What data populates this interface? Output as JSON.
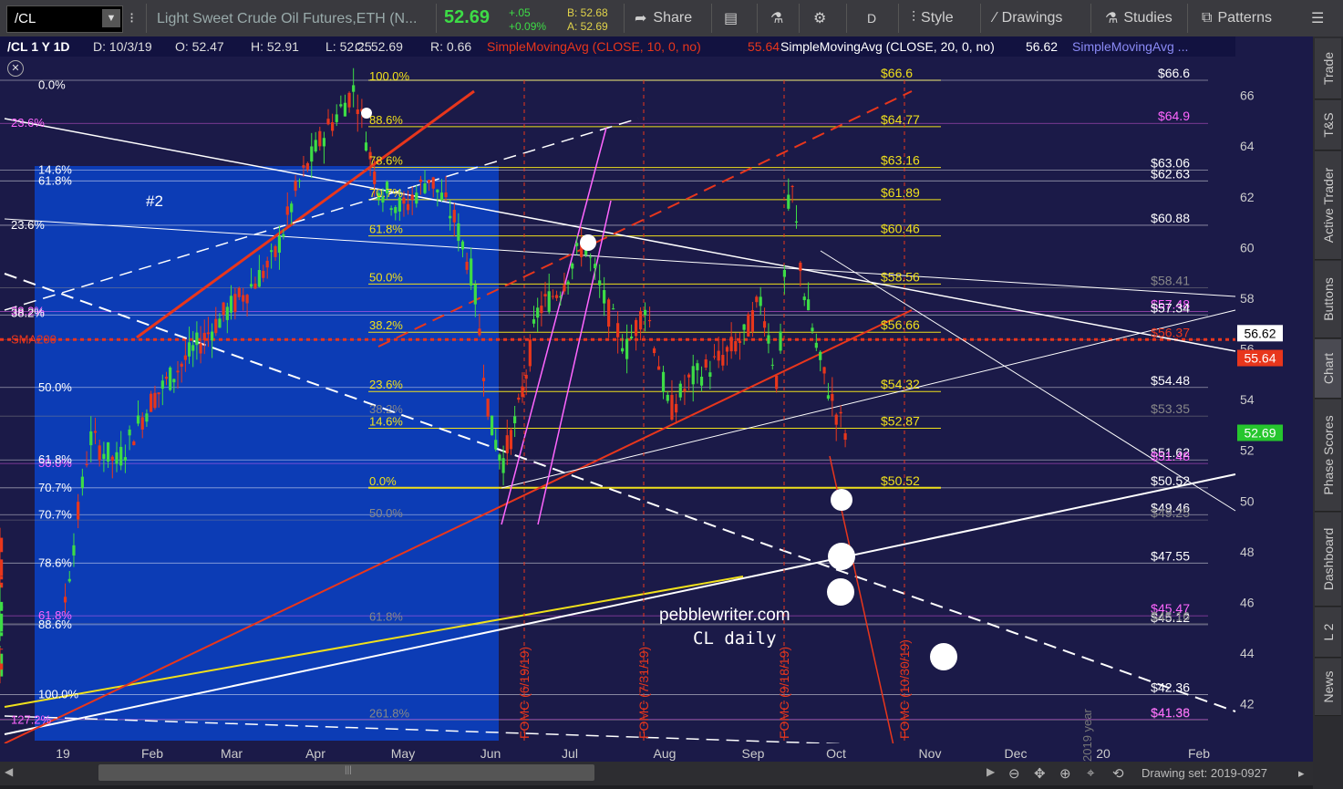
{
  "toolbar": {
    "symbol": "/CL",
    "description": "Light Sweet Crude Oil Futures,ETH (N...",
    "last": "52.69",
    "change": "+.05",
    "change_pct": "+0.09%",
    "bid": "B: 52.68",
    "ask": "A: 52.69",
    "share_label": "Share",
    "period_label": "D",
    "style_label": "Style",
    "drawings_label": "Drawings",
    "studies_label": "Studies",
    "patterns_label": "Patterns"
  },
  "header": {
    "symbol": "/CL 1 Y 1D",
    "date": "D: 10/3/19",
    "open": "O: 52.47",
    "high": "H: 52.91",
    "low": "L: 52.25",
    "close": "C: 52.69",
    "range": "R: 0.66",
    "sma10_label": "SimpleMovingAvg (CLOSE, 10, 0, no)",
    "sma10_value": "55.64",
    "sma20_label": "SimpleMovingAvg (CLOSE, 20, 0, no)",
    "sma20_value": "56.62",
    "sma_more_label": "SimpleMovingAvg ..."
  },
  "right_tabs": [
    "Trade",
    "T&S",
    "Active Trader",
    "Buttons",
    "Chart",
    "Phase Scores",
    "Dashboard",
    "L 2",
    "News"
  ],
  "status": {
    "drawing_set": "Drawing set: 2019-0927"
  },
  "colors": {
    "background": "#1b1a48",
    "highlight": "#0c3cb5",
    "sma10": "#e8361c",
    "sma20": "#ffffff",
    "sma50": "#7b7bf0",
    "sma200": "#f0e01c",
    "up": "#3ddc46",
    "down": "#e8361c",
    "fib_pink": "#ff66ff"
  },
  "chart_data": {
    "type": "candlestick",
    "yaxis": {
      "range": [
        41.3,
        66.6
      ],
      "ticks": [
        42,
        44,
        46,
        48,
        50,
        52,
        54,
        56,
        58,
        60,
        62,
        64,
        66
      ]
    },
    "xaxis": {
      "ticks": [
        "19",
        "Feb",
        "Mar",
        "Apr",
        "May",
        "Jun",
        "Jul",
        "Aug",
        "Sep",
        "Oct",
        "Nov",
        "Dec",
        "20",
        "Feb"
      ]
    },
    "ohlc_last": {
      "open": 52.47,
      "high": 52.91,
      "low": 52.25,
      "close": 52.69
    },
    "price_levels": [
      {
        "value": 66.6,
        "label": "$66.6",
        "color": "#f0e01c"
      },
      {
        "value": 64.77,
        "label": "$64.77",
        "color": "#f0e01c"
      },
      {
        "value": 63.16,
        "label": "$63.16",
        "color": "#f0e01c"
      },
      {
        "value": 61.89,
        "label": "$61.89",
        "color": "#f0e01c"
      },
      {
        "value": 60.46,
        "label": "$60.46",
        "color": "#f0e01c"
      },
      {
        "value": 58.56,
        "label": "$58.56",
        "color": "#f0e01c"
      },
      {
        "value": 56.66,
        "label": "$56.66",
        "color": "#f0e01c"
      },
      {
        "value": 54.32,
        "label": "$54.32",
        "color": "#f0e01c"
      },
      {
        "value": 52.87,
        "label": "$52.87",
        "color": "#f0e01c"
      },
      {
        "value": 50.52,
        "label": "$50.52",
        "color": "#f0e01c"
      }
    ],
    "right_levels": [
      {
        "value": 66.6,
        "label": "$66.6",
        "color": "#ffffff"
      },
      {
        "value": 64.9,
        "label": "$64.9",
        "color": "#ff66ff"
      },
      {
        "value": 63.06,
        "label": "$63.06",
        "color": "#ffffff"
      },
      {
        "value": 62.63,
        "label": "$62.63",
        "color": "#ffffff"
      },
      {
        "value": 60.88,
        "label": "$60.88",
        "color": "#ffffff"
      },
      {
        "value": 58.41,
        "label": "$58.41",
        "color": "#888888"
      },
      {
        "value": 57.48,
        "label": "$57.48",
        "color": "#ff66ff"
      },
      {
        "value": 57.34,
        "label": "$57.34",
        "color": "#ffffff"
      },
      {
        "value": 56.37,
        "label": "$56.37",
        "color": "#e8361c"
      },
      {
        "value": 54.48,
        "label": "$54.48",
        "color": "#ffffff"
      },
      {
        "value": 53.35,
        "label": "$53.35",
        "color": "#888888"
      },
      {
        "value": 51.62,
        "label": "$51.62",
        "color": "#ffffff"
      },
      {
        "value": 51.48,
        "label": "$51.48",
        "color": "#ff66ff"
      },
      {
        "value": 50.52,
        "label": "$50.52",
        "color": "#ffffff"
      },
      {
        "value": 49.46,
        "label": "$49.46",
        "color": "#ffffff"
      },
      {
        "value": 49.25,
        "label": "$49.25",
        "color": "#888888"
      },
      {
        "value": 47.55,
        "label": "$47.55",
        "color": "#ffffff"
      },
      {
        "value": 45.47,
        "label": "$45.47",
        "color": "#ff66ff"
      },
      {
        "value": 45.12,
        "label": "$45.12",
        "color": "#ffffff"
      },
      {
        "value": 45.16,
        "label": "$45.16",
        "color": "#888888"
      },
      {
        "value": 42.36,
        "label": "$42.36",
        "color": "#ffffff"
      },
      {
        "value": 41.36,
        "label": "$41.36",
        "color": "#888888"
      },
      {
        "value": 41.38,
        "label": "$41.38",
        "color": "#ff66ff"
      }
    ],
    "axis_badges": [
      {
        "value": 56.62,
        "label": "56.62",
        "bg": "#ffffff",
        "fg": "#000000"
      },
      {
        "value": 55.64,
        "label": "55.64",
        "bg": "#e8361c",
        "fg": "#ffffff"
      },
      {
        "value": 52.69,
        "label": "52.69",
        "bg": "#26c62e",
        "fg": "#ffffff"
      }
    ],
    "fib_labels_left": [
      {
        "text": "0.0%",
        "value": 66.4,
        "color": "#ffffff"
      },
      {
        "text": "23.6%",
        "value": 64.9,
        "color": "#ff66ff"
      },
      {
        "text": "14.6%",
        "value": 63.05,
        "color": "#ffffff"
      },
      {
        "text": "61.8%",
        "value": 62.63,
        "color": "#ffffff"
      },
      {
        "text": "23.6%",
        "value": 60.88,
        "color": "#ffffff"
      },
      {
        "text": "38.2%",
        "value": 57.48,
        "color": "#ff66ff"
      },
      {
        "text": "38.2%",
        "value": 57.4,
        "color": "#ffffff"
      },
      {
        "text": "SMA200",
        "value": 56.37,
        "color": "#e8361c"
      },
      {
        "text": "50.0%",
        "value": 54.48,
        "color": "#ffffff"
      },
      {
        "text": "50.0%",
        "value": 51.48,
        "color": "#ff66ff"
      },
      {
        "text": "61.8%",
        "value": 51.62,
        "color": "#ffffff"
      },
      {
        "text": "70.7%",
        "value": 50.52,
        "color": "#ffffff"
      },
      {
        "text": "70.7%",
        "value": 49.46,
        "color": "#ffffff"
      },
      {
        "text": "78.6%",
        "value": 47.55,
        "color": "#ffffff"
      },
      {
        "text": "61.8%",
        "value": 45.47,
        "color": "#ff66ff"
      },
      {
        "text": "88.6%",
        "value": 45.12,
        "color": "#ffffff"
      },
      {
        "text": "100.0%",
        "value": 42.36,
        "color": "#ffffff"
      },
      {
        "text": "127.2%",
        "value": 41.36,
        "color": "#ff66ff"
      }
    ],
    "fib_labels_mid": [
      {
        "text": "100.0%",
        "value": 66.5,
        "color": "#f0e01c"
      },
      {
        "text": "88.6%",
        "value": 64.77,
        "color": "#f0e01c"
      },
      {
        "text": "78.6%",
        "value": 63.16,
        "color": "#f0e01c"
      },
      {
        "text": "70.7%",
        "value": 61.89,
        "color": "#f0e01c"
      },
      {
        "text": "61.8%",
        "value": 60.46,
        "color": "#f0e01c"
      },
      {
        "text": "50.0%",
        "value": 58.56,
        "color": "#f0e01c"
      },
      {
        "text": "38.2%",
        "value": 56.66,
        "color": "#f0e01c"
      },
      {
        "text": "23.6%",
        "value": 54.32,
        "color": "#f0e01c"
      },
      {
        "text": "38.2%",
        "value": 53.35,
        "color": "#888888"
      },
      {
        "text": "14.6%",
        "value": 52.87,
        "color": "#f0e01c"
      },
      {
        "text": "0.0%",
        "value": 50.52,
        "color": "#f0e01c"
      },
      {
        "text": "50.0%",
        "value": 49.25,
        "color": "#888888"
      },
      {
        "text": "61.8%",
        "value": 45.16,
        "color": "#888888"
      },
      {
        "text": "261.8%",
        "value": 41.36,
        "color": "#888888"
      }
    ],
    "annotations": {
      "site": "pebblewriter.com",
      "subtitle": "CL daily",
      "wave": "#2",
      "year_label": "2019 year",
      "fomc": [
        "FOMC (6/19/19)",
        "FOMC (7/31/19)",
        "FOMC (9/18/19)",
        "FOMC (10/30/19)"
      ]
    }
  }
}
